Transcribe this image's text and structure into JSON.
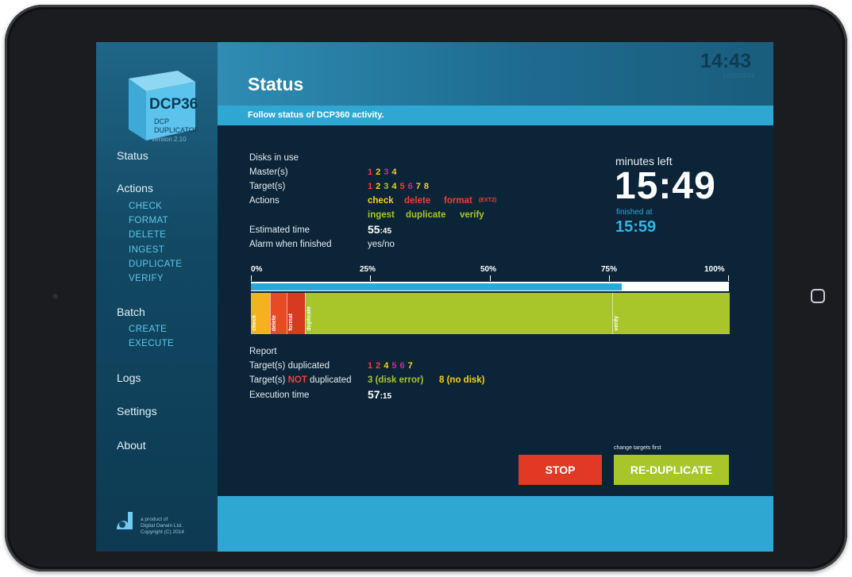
{
  "app": {
    "logo_text": "DCP360",
    "logo_subtext_line1": "DCP",
    "logo_subtext_line2": "DUPLICATOR",
    "version": "version 2.10",
    "clock": "14:43",
    "date": "12/03/2014",
    "credit_line1": "a product of",
    "credit_line2": "Digital Darwin Ltd.",
    "credit_line3": "Copyright (C) 2014"
  },
  "sidebar": {
    "status": "Status",
    "actions": "Actions",
    "actions_items": [
      "CHECK",
      "FORMAT",
      "DELETE",
      "INGEST",
      "DUPLICATE",
      "VERIFY"
    ],
    "batch": "Batch",
    "batch_items": [
      "CREATE",
      "EXECUTE"
    ],
    "logs": "Logs",
    "settings": "Settings",
    "about": "About"
  },
  "header": {
    "title": "Status",
    "subtitle": "Follow status of DCP360 activity."
  },
  "status": {
    "disks_in_use_label": "Disks in use",
    "masters_label": "Master(s)",
    "masters": [
      {
        "n": "1",
        "color": "red"
      },
      {
        "n": "2",
        "color": "yel"
      },
      {
        "n": "3",
        "color": "mag"
      },
      {
        "n": "4",
        "color": "yel"
      }
    ],
    "targets_label": "Target(s)",
    "targets": [
      {
        "n": "1",
        "color": "red"
      },
      {
        "n": "2",
        "color": "yel"
      },
      {
        "n": "3",
        "color": "grn"
      },
      {
        "n": "4",
        "color": "yel"
      },
      {
        "n": "5",
        "color": "red"
      },
      {
        "n": "6",
        "color": "mag"
      },
      {
        "n": "7",
        "color": "yel"
      },
      {
        "n": "8",
        "color": "yel"
      }
    ],
    "actions_label": "Actions",
    "action_check": "check",
    "action_delete": "delete",
    "action_format": "format",
    "action_format_note": "(EXT2)",
    "action_ingest": "ingest",
    "action_duplicate": "duplicate",
    "action_verify": "verify",
    "estimated_time_label": "Estimated time",
    "estimated_time_main": "55",
    "estimated_time_small": ":45",
    "alarm_label": "Alarm when finished",
    "alarm_value": "yes/no",
    "minutes_left_label": "minutes left",
    "minutes_left": "15:49",
    "finished_at_label": "finished at",
    "finished_at": "15:59"
  },
  "progress": {
    "ticks": [
      "0%",
      "25%",
      "50%",
      "75%",
      "100%"
    ],
    "fraction": 0.775,
    "phases": [
      {
        "label": "check",
        "color": "#f6b21d",
        "start": 0.0,
        "end": 0.04
      },
      {
        "label": "delete",
        "color": "#e84a24",
        "start": 0.04,
        "end": 0.075
      },
      {
        "label": "format",
        "color": "#d63a20",
        "start": 0.075,
        "end": 0.113
      },
      {
        "label": "duplicate",
        "color": "#a8c62a",
        "start": 0.113,
        "end": 0.755
      },
      {
        "label": "verify",
        "color": "#a8c62a",
        "start": 0.755,
        "end": 1.0
      }
    ]
  },
  "report": {
    "label": "Report",
    "duplicated_label": "Target(s) duplicated",
    "duplicated": [
      {
        "n": "1",
        "color": "red"
      },
      {
        "n": "2",
        "color": "red"
      },
      {
        "n": "4",
        "color": "yel"
      },
      {
        "n": "5",
        "color": "mag"
      },
      {
        "n": "6",
        "color": "mag"
      },
      {
        "n": "7",
        "color": "yel"
      }
    ],
    "not_dup_label_pre": "Target(s) ",
    "not_dup_label_not": "NOT",
    "not_dup_label_post": " duplicated",
    "not_dup_item1": "3 (disk error)",
    "not_dup_item2": "8 (no disk)",
    "exec_time_label": "Execution time",
    "exec_time_main": "57",
    "exec_time_small": ":15"
  },
  "buttons": {
    "stop": "STOP",
    "reduplicate": "RE-DUPLICATE",
    "change_note": "change targets first"
  }
}
